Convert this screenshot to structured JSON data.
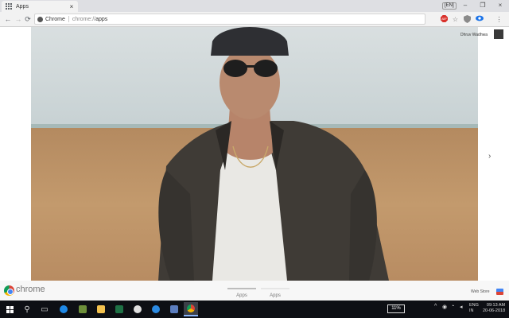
{
  "browser": {
    "tab": {
      "title": "Apps",
      "close": "×"
    },
    "profile_badge": "[EN]",
    "window_controls": {
      "minimize": "–",
      "maximize": "❐",
      "close": "×"
    }
  },
  "toolbar": {
    "back": "←",
    "forward": "→",
    "reload": "⟳",
    "omnibox": {
      "origin": "Chrome",
      "url_prefix": "chrome://",
      "url_path": "apps"
    },
    "extensions": [
      "abp-icon",
      "star-icon",
      "shield-icon",
      "eye-icon",
      "menu-icon"
    ]
  },
  "page": {
    "user_name": "Dhruv Wadhwa",
    "next_arrow": "›",
    "footer": {
      "brand": "chrome",
      "tabs": [
        {
          "label": "Apps",
          "active": true
        },
        {
          "label": "Apps",
          "active": false
        }
      ],
      "webstore": "Web Store"
    }
  },
  "taskbar": {
    "battery": "11%",
    "lang": [
      "ENG",
      "IN"
    ],
    "time": "09:13 AM",
    "date": "20-06-2018"
  },
  "colors": {
    "accent": "#4285f4",
    "taskbar": "#0d0f14",
    "sky": "#cfd7d9",
    "field": "#b88a5f"
  }
}
